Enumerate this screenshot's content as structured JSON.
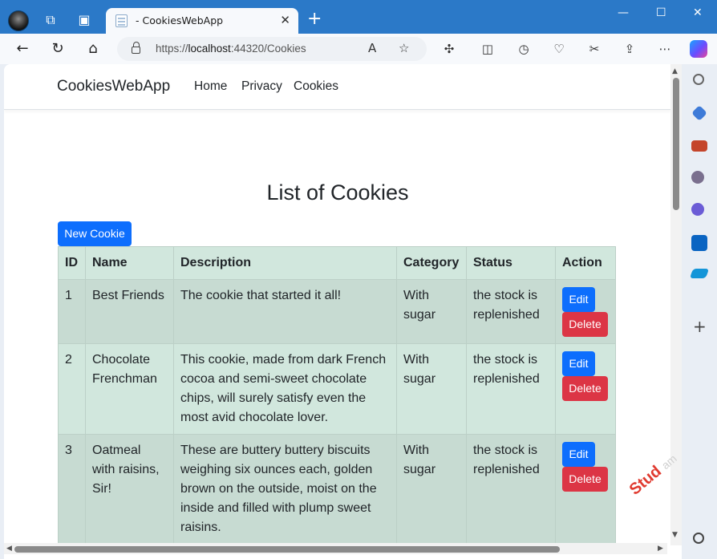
{
  "browser": {
    "tab_title": "- CookiesWebApp",
    "url_prefix": "https://",
    "url_host": "localhost",
    "url_path": ":44320/Cookies",
    "tab_close": "✕",
    "new_tab": "+",
    "window_minimize": "—",
    "window_maximize": "☐",
    "window_close": "✕"
  },
  "site": {
    "brand": "CookiesWebApp",
    "nav": [
      "Home",
      "Privacy",
      "Cookies"
    ]
  },
  "page": {
    "title": "List of Cookies",
    "new_button": "New Cookie"
  },
  "table": {
    "headers": [
      "ID",
      "Name",
      "Description",
      "Category",
      "Status",
      "Action"
    ],
    "rows": [
      {
        "id": "1",
        "name": "Best Friends",
        "description": "The cookie that started it all!",
        "category": "With sugar",
        "status": "the stock is replenished",
        "edit": "Edit",
        "delete": "Delete"
      },
      {
        "id": "2",
        "name": "Chocolate Frenchman",
        "description": "This cookie, made from dark French cocoa and semi-sweet chocolate chips, will surely satisfy even the most avid chocolate lover.",
        "category": "With sugar",
        "status": "the stock is replenished",
        "edit": "Edit",
        "delete": "Delete"
      },
      {
        "id": "3",
        "name": "Oatmeal with raisins, Sir!",
        "description": "These are buttery buttery biscuits weighing six ounces each, golden brown on the outside, moist on the inside and filled with plump sweet raisins.",
        "category": "With sugar",
        "status": "the stock is replenished",
        "edit": "Edit",
        "delete": "Delete"
      }
    ]
  },
  "watermark": {
    "text": "Stud",
    "suffix": "am"
  },
  "colors": {
    "primary": "#0d6efd",
    "danger": "#dc3545",
    "table_bg": "#d1e7dd",
    "titlebar": "#2b79c8"
  }
}
